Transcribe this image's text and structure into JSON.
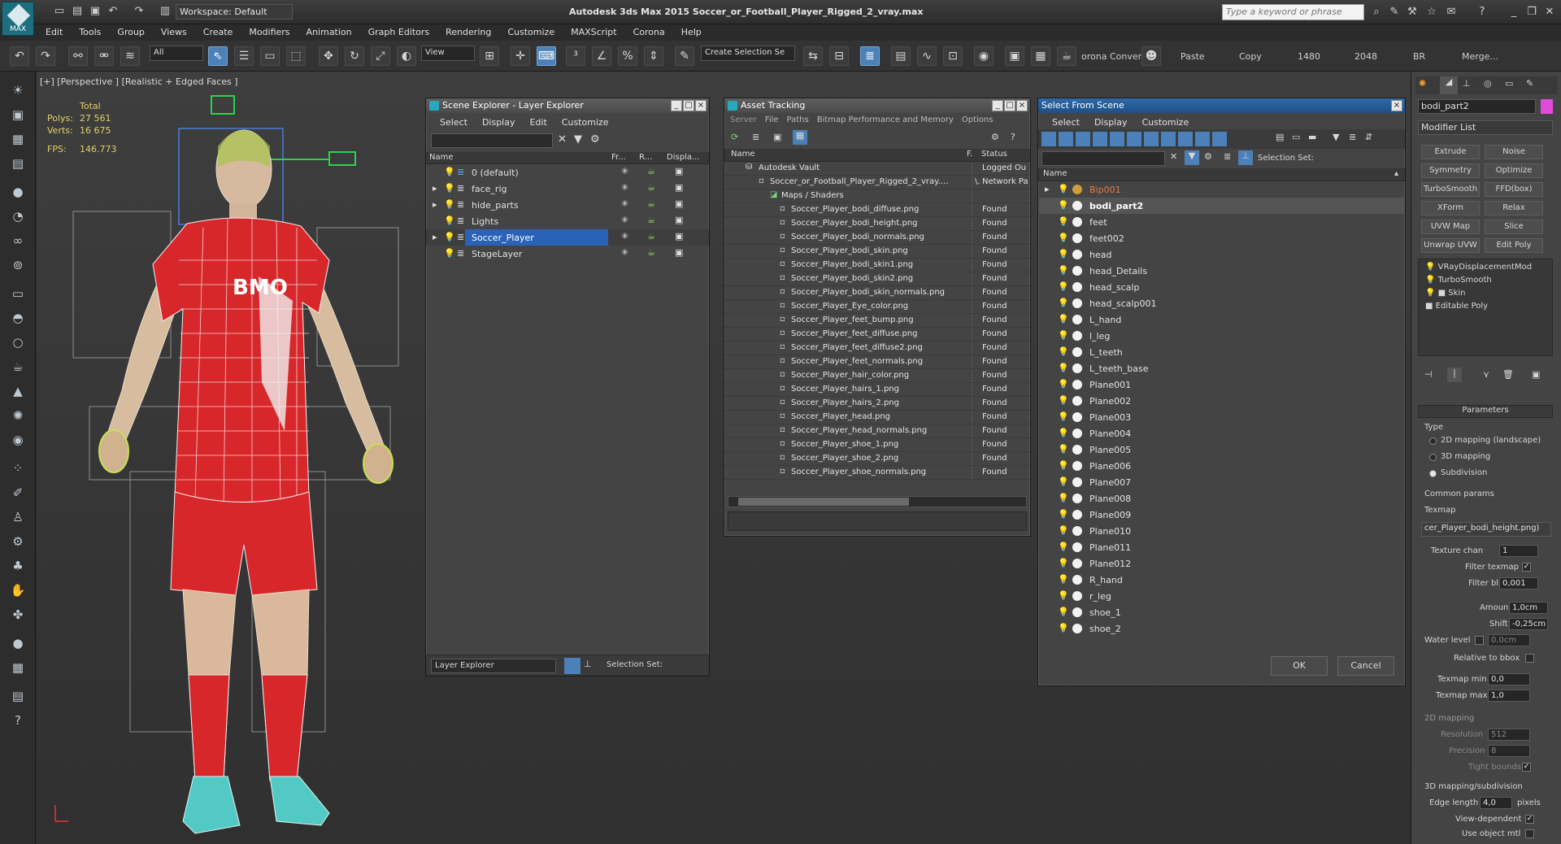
{
  "app": {
    "title": "Autodesk 3ds Max  2015     Soccer_or_Football_Player_Rigged_2_vray.max",
    "logo": "MAX",
    "workspace": "Workspace: Default",
    "search_placeholder": "Type a keyword or phrase"
  },
  "menu": [
    "Edit",
    "Tools",
    "Group",
    "Views",
    "Create",
    "Modifiers",
    "Animation",
    "Graph Editors",
    "Rendering",
    "Customize",
    "MAXScript",
    "Corona",
    "Help"
  ],
  "toolbar": {
    "filter": "All",
    "refcoord": "View",
    "selset": "Create Selection Se",
    "corona": "orona Convert",
    "paste": "Paste",
    "copy": "Copy",
    "n1480": "1480",
    "n2048": "2048",
    "br": "BR",
    "merge": "Merge..."
  },
  "viewport": {
    "label": "[+] [Perspective ] [Realistic + Edged Faces ]",
    "total": "Total",
    "polys_label": "Polys:",
    "polys": "27 561",
    "verts_label": "Verts:",
    "verts": "16 675",
    "fps_label": "FPS:",
    "fps": "146.773",
    "jersey_text": "BMO"
  },
  "scene_explorer": {
    "title": "Scene Explorer - Layer Explorer",
    "menu": [
      "Select",
      "Display",
      "Edit",
      "Customize"
    ],
    "cols": [
      "Name",
      "Fr...",
      "R...",
      "Displa..."
    ],
    "rows": [
      "0 (default)",
      "face_rig",
      "hide_parts",
      "Lights",
      "Soccer_Player",
      "StageLayer"
    ],
    "footer_combo": "Layer Explorer",
    "selection_set": "Selection Set:"
  },
  "asset_tracking": {
    "title": "Asset Tracking",
    "menu": [
      "Server",
      "File",
      "Paths",
      "Bitmap Performance and Memory",
      "Options"
    ],
    "cols": [
      "Name",
      "F.",
      "Status"
    ],
    "vault": "Autodesk Vault",
    "vault_status": "Logged Ou",
    "file": "Soccer_or_Football_Player_Rigged_2_vray....",
    "file_f": "\\.",
    "file_status": "Network Pa",
    "maps": "Maps / Shaders",
    "files": [
      "Soccer_Player_bodi_diffuse.png",
      "Soccer_Player_bodi_height.png",
      "Soccer_Player_bodi_normals.png",
      "Soccer_Player_bodi_skin.png",
      "Soccer_Player_bodi_skin1.png",
      "Soccer_Player_bodi_skin2.png",
      "Soccer_Player_bodi_skin_normals.png",
      "Soccer_Player_Eye_color.png",
      "Soccer_Player_feet_bump.png",
      "Soccer_Player_feet_diffuse.png",
      "Soccer_Player_feet_diffuse2.png",
      "Soccer_Player_feet_normals.png",
      "Soccer_Player_hair_color.png",
      "Soccer_Player_hairs_1.png",
      "Soccer_Player_hairs_2.png",
      "Soccer_Player_head.png",
      "Soccer_Player_head_normals.png",
      "Soccer_Player_shoe_1.png",
      "Soccer_Player_shoe_2.png",
      "Soccer_Player_shoe_normals.png"
    ],
    "found": "Found"
  },
  "select_scene": {
    "title": "Select From Scene",
    "menu": [
      "Select",
      "Display",
      "Customize"
    ],
    "selection_set": "Selection Set:",
    "col_name": "Name",
    "items": [
      "Bip001",
      "bodi_part2",
      "feet",
      "feet002",
      "head",
      "head_Details",
      "head_scalp",
      "head_scalp001",
      "L_hand",
      "l_leg",
      "L_teeth",
      "L_teeth_base",
      "Plane001",
      "Plane002",
      "Plane003",
      "Plane004",
      "Plane005",
      "Plane006",
      "Plane007",
      "Plane008",
      "Plane009",
      "Plane010",
      "Plane011",
      "Plane012",
      "R_hand",
      "r_leg",
      "shoe_1",
      "shoe_2"
    ],
    "ok": "OK",
    "cancel": "Cancel"
  },
  "command_panel": {
    "object_name": "bodi_part2",
    "modifier_list": "Modifier List",
    "buttons": [
      "Extrude",
      "Noise",
      "Symmetry",
      "Optimize",
      "TurboSmooth",
      "FFD(box)",
      "XForm",
      "Relax",
      "UVW Map",
      "Slice",
      "Unwrap UVW",
      "Edit Poly"
    ],
    "stack": [
      "VRayDisplacementMod",
      "TurboSmooth",
      "Skin",
      "Editable Poly"
    ],
    "parameters": "Parameters",
    "type": "Type",
    "type_opts": [
      "2D mapping (landscape)",
      "3D mapping",
      "Subdivision"
    ],
    "common": "Common params",
    "texmap": "Texmap",
    "texmap_val": "cer_Player_bodi_height.png)",
    "texture_chan": "Texture chan",
    "texture_chan_val": "1",
    "filter_texmap": "Filter texmap",
    "filter_blur": "Filter blur",
    "filter_blur_val": "0,001",
    "amount": "Amount",
    "amount_val": "1,0cm",
    "shift": "Shift",
    "shift_val": "-0,25cm",
    "water": "Water level",
    "water_val": "0,0cm",
    "relbbox": "Relative to bbox",
    "tmin": "Texmap min",
    "tmin_val": "0,0",
    "tmax": "Texmap max",
    "tmax_val": "1,0",
    "map2d": "2D mapping",
    "resolution": "Resolution",
    "resolution_val": "512",
    "precision": "Precision",
    "precision_val": "8",
    "tight": "Tight bounds",
    "map3d": "3D mapping/subdivision",
    "edge": "Edge length",
    "edge_val": "4,0",
    "pixels": "pixels",
    "viewdep": "View-dependent",
    "useobj": "Use object mtl"
  }
}
